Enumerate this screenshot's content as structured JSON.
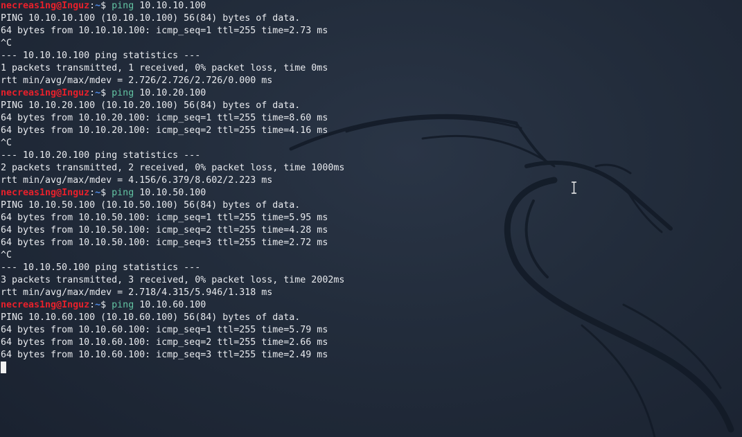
{
  "prompt": {
    "user": "necreas1ng",
    "at": "@",
    "host": "Inguz",
    "sep": ":",
    "path": "~",
    "symbol": "$"
  },
  "colors": {
    "prompt_user": "#e8202b",
    "path": "#4f8be8",
    "command": "#63c4a3",
    "text": "#e8eaee",
    "background": "#1f2a38"
  },
  "icons": {
    "wallpaper": "kali-dragon-icon",
    "cursor": "text-cursor-icon"
  },
  "lines": [
    {
      "type": "prompt",
      "cmd": "ping",
      "arg": "10.10.10.100"
    },
    {
      "type": "out",
      "text": "PING 10.10.10.100 (10.10.10.100) 56(84) bytes of data."
    },
    {
      "type": "out",
      "text": "64 bytes from 10.10.10.100: icmp_seq=1 ttl=255 time=2.73 ms"
    },
    {
      "type": "out",
      "text": "^C"
    },
    {
      "type": "out",
      "text": "--- 10.10.10.100 ping statistics ---"
    },
    {
      "type": "out",
      "text": "1 packets transmitted, 1 received, 0% packet loss, time 0ms"
    },
    {
      "type": "out",
      "text": "rtt min/avg/max/mdev = 2.726/2.726/2.726/0.000 ms"
    },
    {
      "type": "prompt",
      "cmd": "ping",
      "arg": "10.10.20.100"
    },
    {
      "type": "out",
      "text": "PING 10.10.20.100 (10.10.20.100) 56(84) bytes of data."
    },
    {
      "type": "out",
      "text": "64 bytes from 10.10.20.100: icmp_seq=1 ttl=255 time=8.60 ms"
    },
    {
      "type": "out",
      "text": "64 bytes from 10.10.20.100: icmp_seq=2 ttl=255 time=4.16 ms"
    },
    {
      "type": "out",
      "text": "^C"
    },
    {
      "type": "out",
      "text": "--- 10.10.20.100 ping statistics ---"
    },
    {
      "type": "out",
      "text": "2 packets transmitted, 2 received, 0% packet loss, time 1000ms"
    },
    {
      "type": "out",
      "text": "rtt min/avg/max/mdev = 4.156/6.379/8.602/2.223 ms"
    },
    {
      "type": "prompt",
      "cmd": "ping",
      "arg": "10.10.50.100"
    },
    {
      "type": "out",
      "text": "PING 10.10.50.100 (10.10.50.100) 56(84) bytes of data."
    },
    {
      "type": "out",
      "text": "64 bytes from 10.10.50.100: icmp_seq=1 ttl=255 time=5.95 ms"
    },
    {
      "type": "out",
      "text": "64 bytes from 10.10.50.100: icmp_seq=2 ttl=255 time=4.28 ms"
    },
    {
      "type": "out",
      "text": "64 bytes from 10.10.50.100: icmp_seq=3 ttl=255 time=2.72 ms"
    },
    {
      "type": "out",
      "text": "^C"
    },
    {
      "type": "out",
      "text": "--- 10.10.50.100 ping statistics ---"
    },
    {
      "type": "out",
      "text": "3 packets transmitted, 3 received, 0% packet loss, time 2002ms"
    },
    {
      "type": "out",
      "text": "rtt min/avg/max/mdev = 2.718/4.315/5.946/1.318 ms"
    },
    {
      "type": "prompt",
      "cmd": "ping",
      "arg": "10.10.60.100"
    },
    {
      "type": "out",
      "text": "PING 10.10.60.100 (10.10.60.100) 56(84) bytes of data."
    },
    {
      "type": "out",
      "text": "64 bytes from 10.10.60.100: icmp_seq=1 ttl=255 time=5.79 ms"
    },
    {
      "type": "out",
      "text": "64 bytes from 10.10.60.100: icmp_seq=2 ttl=255 time=2.66 ms"
    },
    {
      "type": "out",
      "text": "64 bytes from 10.10.60.100: icmp_seq=3 ttl=255 time=2.49 ms"
    },
    {
      "type": "cursor"
    }
  ]
}
